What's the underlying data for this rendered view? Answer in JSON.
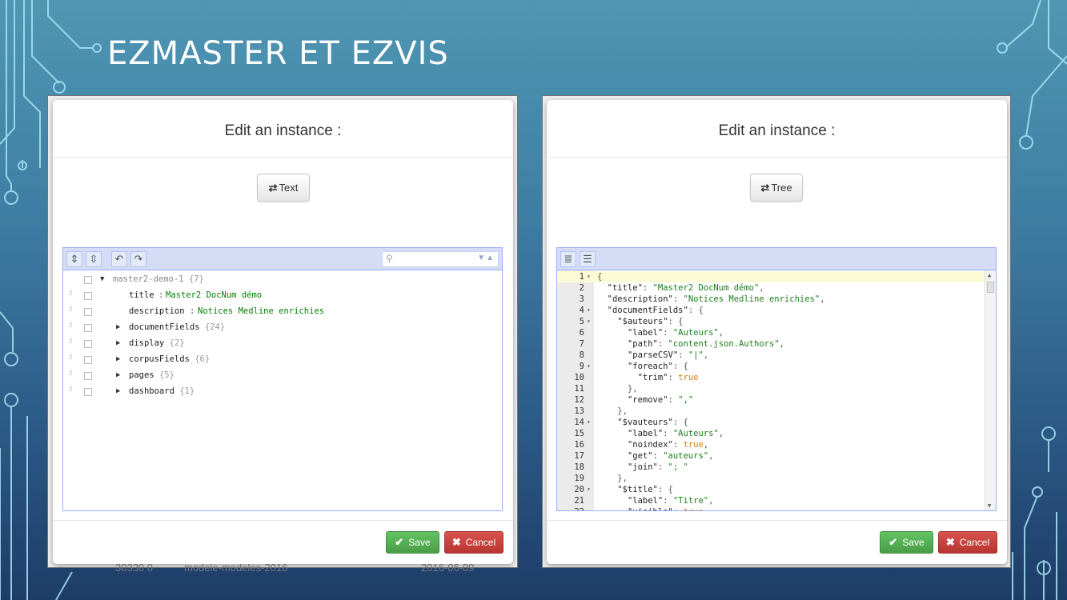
{
  "slide": {
    "title": "EZMASTER ET EZVIS"
  },
  "background_text": {
    "left_id": "30330 0",
    "model": "modele-modeles-2016",
    "date": "2016-06-09"
  },
  "left_modal": {
    "title": "Edit an instance :",
    "toggle_label": "Text",
    "toggle_icon": "retweet-icon",
    "tree": {
      "root_label": "master2-demo-1",
      "root_count": "{7}",
      "fields": [
        {
          "key": "title",
          "value": "Master2 DocNum démo"
        },
        {
          "key": "description",
          "value": "Notices Medline enrichies"
        }
      ],
      "objects": [
        {
          "key": "documentFields",
          "count": "{24}"
        },
        {
          "key": "display",
          "count": "{2}"
        },
        {
          "key": "corpusFields",
          "count": "{6}"
        },
        {
          "key": "pages",
          "count": "{5}"
        },
        {
          "key": "dashboard",
          "count": "{1}"
        }
      ],
      "separator": ":"
    },
    "save_label": "Save",
    "cancel_label": "Cancel"
  },
  "right_modal": {
    "title": "Edit an instance :",
    "toggle_label": "Tree",
    "toggle_icon": "retweet-icon",
    "code_lines": [
      "{",
      "  \"title\": \"Master2 DocNum démo\",",
      "  \"description\": \"Notices Medline enrichies\",",
      "  \"documentFields\": {",
      "    \"$auteurs\": {",
      "      \"label\": \"Auteurs\",",
      "      \"path\": \"content.json.Authors\",",
      "      \"parseCSV\": \"|\",",
      "      \"foreach\": {",
      "        \"trim\": true",
      "      },",
      "      \"remove\": \",\"",
      "    },",
      "    \"$vauteurs\": {",
      "      \"label\": \"Auteurs\",",
      "      \"noindex\": true,",
      "      \"get\": \"auteurs\",",
      "      \"join\": \"; \"",
      "    },",
      "    \"$title\": {",
      "      \"label\": \"Titre\",",
      "      \"visible\": true,"
    ],
    "save_label": "Save",
    "cancel_label": "Cancel"
  },
  "colors": {
    "save": "#5cb85c",
    "cancel": "#d9534f",
    "editor_border": "#97b0f8",
    "json_string": "#1a7f1a",
    "json_bool": "#c5851a"
  }
}
